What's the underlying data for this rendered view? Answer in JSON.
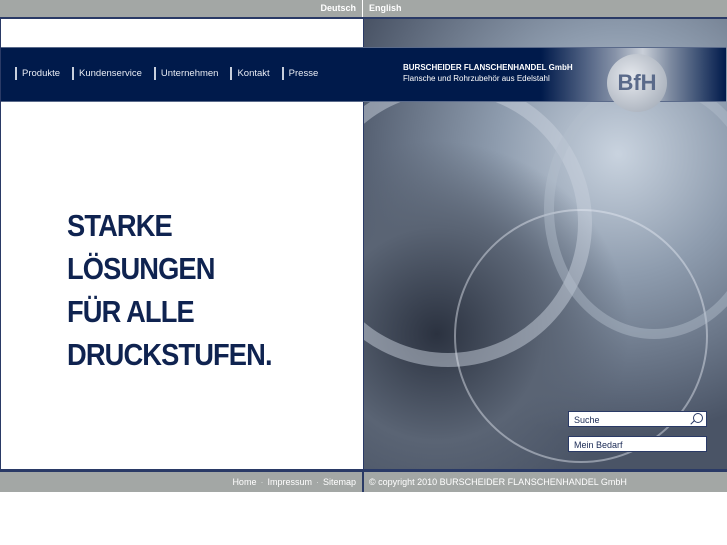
{
  "languages": {
    "de": "Deutsch",
    "en": "English"
  },
  "nav": [
    "Produkte",
    "Kundenservice",
    "Unternehmen",
    "Kontakt",
    "Presse"
  ],
  "company": {
    "name": "BURSCHEIDER FLANSCHENHANDEL GmbH",
    "tagline": "Flansche und Rohrzubehör aus Edelstahl",
    "logo_text": "BfH"
  },
  "headline": [
    "STARKE",
    "LÖSUNGEN",
    "FÜR ALLE",
    "DRUCKSTUFEN."
  ],
  "search": {
    "placeholder": "Suche"
  },
  "mein_bedarf": "Mein Bedarf",
  "footer": {
    "links": [
      "Home",
      "Impressum",
      "Sitemap"
    ],
    "separator": "·",
    "copyright": "© copyright 2010 BURSCHEIDER FLANSCHENHANDEL GmbH"
  }
}
